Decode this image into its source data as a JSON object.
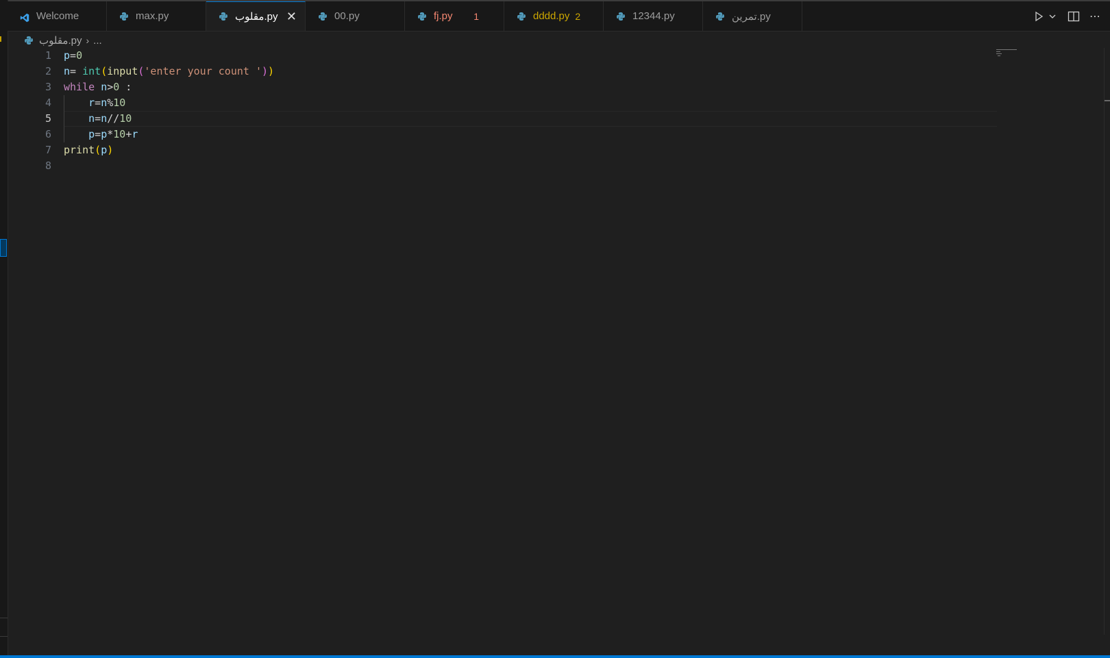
{
  "tabs": [
    {
      "label": "Welcome",
      "icon": "vscode-logo-icon",
      "state": "normal"
    },
    {
      "label": "max.py",
      "icon": "python-icon",
      "state": "normal"
    },
    {
      "label": "مقلوب.py",
      "icon": "python-icon",
      "state": "active",
      "close": "✕"
    },
    {
      "label": "00.py",
      "icon": "python-icon",
      "state": "normal"
    },
    {
      "label": "fj.py",
      "icon": "python-icon",
      "state": "error",
      "badge": "1"
    },
    {
      "label": "dddd.py",
      "icon": "python-icon",
      "state": "warning",
      "badge": "2"
    },
    {
      "label": "12344.py",
      "icon": "python-icon",
      "state": "normal"
    },
    {
      "label": "تمرين.py",
      "icon": "python-icon",
      "state": "normal"
    }
  ],
  "actions": {
    "run": "run-icon",
    "dropdown": "chevron-down-icon",
    "split": "split-editor-icon",
    "more": "⋯"
  },
  "breadcrumb": {
    "file": "مقلوب.py",
    "separator": "›",
    "rest": "..."
  },
  "editor": {
    "current_line": 5,
    "line_numbers": [
      "1",
      "2",
      "3",
      "4",
      "5",
      "6",
      "7",
      "8"
    ],
    "lines": [
      [
        {
          "t": "p",
          "c": "var"
        },
        {
          "t": "=",
          "c": "op"
        },
        {
          "t": "0",
          "c": "num"
        }
      ],
      [
        {
          "t": "n",
          "c": "var"
        },
        {
          "t": "= ",
          "c": "op"
        },
        {
          "t": "int",
          "c": "cls"
        },
        {
          "t": "(",
          "c": "p1"
        },
        {
          "t": "input",
          "c": "fn"
        },
        {
          "t": "(",
          "c": "p2"
        },
        {
          "t": "'enter your count '",
          "c": "str"
        },
        {
          "t": ")",
          "c": "p2"
        },
        {
          "t": ")",
          "c": "p1"
        }
      ],
      [
        {
          "t": "while",
          "c": "kw"
        },
        {
          "t": " ",
          "c": "op"
        },
        {
          "t": "n",
          "c": "var"
        },
        {
          "t": ">",
          "c": "op"
        },
        {
          "t": "0",
          "c": "num"
        },
        {
          "t": " :",
          "c": "op"
        }
      ],
      [
        {
          "t": "    ",
          "c": "op"
        },
        {
          "t": "r",
          "c": "var"
        },
        {
          "t": "=",
          "c": "op"
        },
        {
          "t": "n",
          "c": "var"
        },
        {
          "t": "%",
          "c": "op"
        },
        {
          "t": "10",
          "c": "num"
        }
      ],
      [
        {
          "t": "    ",
          "c": "op"
        },
        {
          "t": "n",
          "c": "var"
        },
        {
          "t": "=",
          "c": "op"
        },
        {
          "t": "n",
          "c": "var"
        },
        {
          "t": "//",
          "c": "op"
        },
        {
          "t": "10",
          "c": "num"
        }
      ],
      [
        {
          "t": "    ",
          "c": "op"
        },
        {
          "t": "p",
          "c": "var"
        },
        {
          "t": "=",
          "c": "op"
        },
        {
          "t": "p",
          "c": "var"
        },
        {
          "t": "*",
          "c": "op"
        },
        {
          "t": "10",
          "c": "num"
        },
        {
          "t": "+",
          "c": "op"
        },
        {
          "t": "r",
          "c": "var"
        }
      ],
      [
        {
          "t": "print",
          "c": "fn"
        },
        {
          "t": "(",
          "c": "p1"
        },
        {
          "t": "p",
          "c": "var"
        },
        {
          "t": ")",
          "c": "p1"
        }
      ],
      []
    ]
  },
  "colors": {
    "accent": "#0078d4",
    "error": "#f48771",
    "warning": "#cca700",
    "editor_bg": "#1f1f1f"
  }
}
